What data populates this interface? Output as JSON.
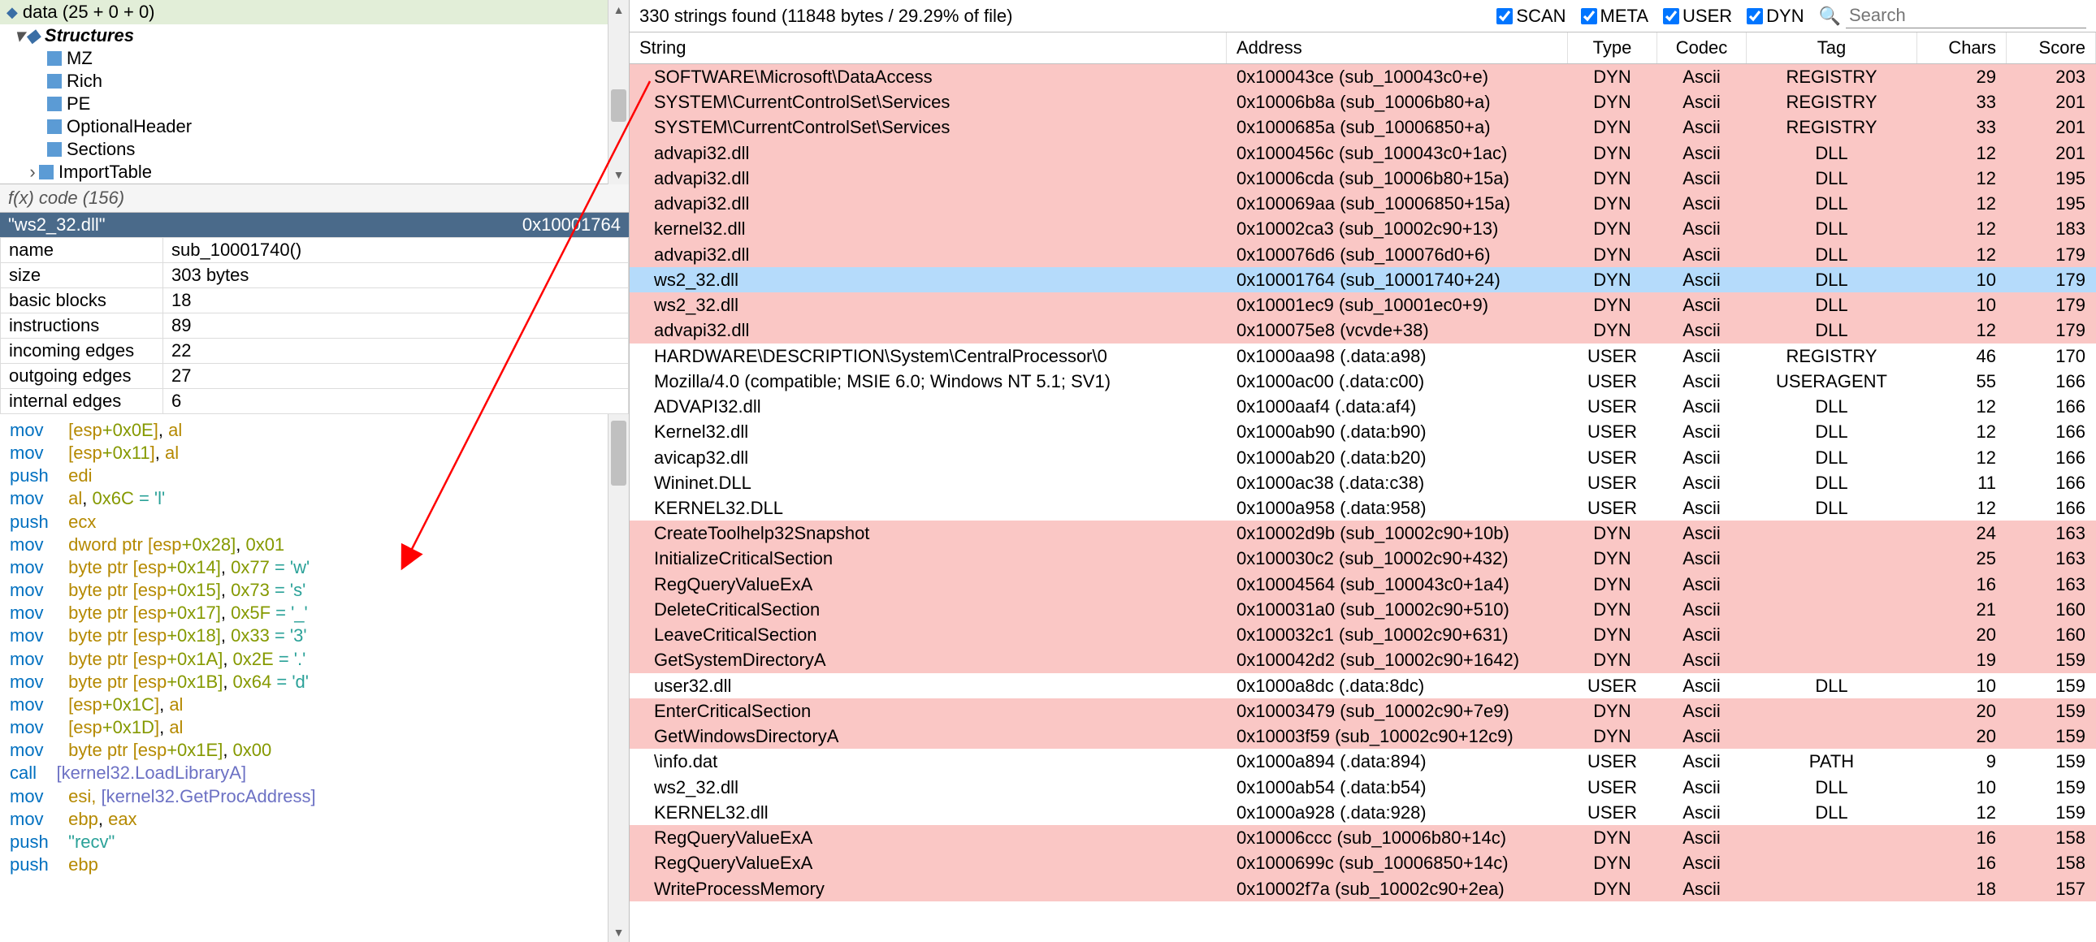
{
  "tree": {
    "header": "data (25 + 0 + 0)",
    "structures_label": "Structures",
    "items": [
      "MZ",
      "Rich",
      "PE",
      "OptionalHeader",
      "Sections",
      "ImportTable"
    ]
  },
  "fxbar": "f(x) code (156)",
  "funchdr": {
    "name": "\"ws2_32.dll\"",
    "addr": "0x10001764"
  },
  "props": [
    {
      "k": "name",
      "v": "sub_10001740()"
    },
    {
      "k": "size",
      "v": "303 bytes"
    },
    {
      "k": "basic blocks",
      "v": "18"
    },
    {
      "k": "instructions",
      "v": "89"
    },
    {
      "k": "incoming edges",
      "v": "22"
    },
    {
      "k": "outgoing edges",
      "v": "27"
    },
    {
      "k": "internal edges",
      "v": "6"
    }
  ],
  "asm": [
    {
      "m": "mov",
      "ops": [
        {
          "t": "mem",
          "s": "[",
          "r": "esp",
          "o": "+0x0E",
          "e": "]"
        },
        {
          "t": "reg",
          "s": ", ",
          "r": "al"
        }
      ]
    },
    {
      "m": "mov",
      "ops": [
        {
          "t": "mem",
          "s": "[",
          "r": "esp",
          "o": "+0x11",
          "e": "]"
        },
        {
          "t": "reg",
          "s": ", ",
          "r": "al"
        }
      ]
    },
    {
      "m": "push",
      "ops": [
        {
          "t": "reg",
          "r": "edi"
        }
      ]
    },
    {
      "m": "mov",
      "ops": [
        {
          "t": "reg",
          "r": "al"
        },
        {
          "t": "imm",
          "s": ", ",
          "v": "0x6C",
          "c": " = 'l'"
        }
      ]
    },
    {
      "m": "push",
      "ops": [
        {
          "t": "reg",
          "r": "ecx"
        }
      ]
    },
    {
      "m": "mov",
      "ops": [
        {
          "t": "txt",
          "s": "dword ptr ["
        },
        {
          "t": "reg",
          "r": "esp"
        },
        {
          "t": "txt2",
          "s": "+0x28], "
        },
        {
          "t": "num",
          "v": "0x01"
        }
      ]
    },
    {
      "m": "mov",
      "ops": [
        {
          "t": "txt",
          "s": "byte ptr ["
        },
        {
          "t": "reg",
          "r": "esp"
        },
        {
          "t": "txt2",
          "s": "+0x14], "
        },
        {
          "t": "num",
          "v": "0x77"
        },
        {
          "t": "ch",
          "s": " = 'w'"
        }
      ]
    },
    {
      "m": "mov",
      "ops": [
        {
          "t": "txt",
          "s": "byte ptr ["
        },
        {
          "t": "reg",
          "r": "esp"
        },
        {
          "t": "txt2",
          "s": "+0x15], "
        },
        {
          "t": "num",
          "v": "0x73"
        },
        {
          "t": "ch",
          "s": " = 's'"
        }
      ]
    },
    {
      "m": "mov",
      "ops": [
        {
          "t": "txt",
          "s": "byte ptr ["
        },
        {
          "t": "reg",
          "r": "esp"
        },
        {
          "t": "txt2",
          "s": "+0x17], "
        },
        {
          "t": "num",
          "v": "0x5F"
        },
        {
          "t": "ch",
          "s": " = '_'"
        }
      ]
    },
    {
      "m": "mov",
      "ops": [
        {
          "t": "txt",
          "s": "byte ptr ["
        },
        {
          "t": "reg",
          "r": "esp"
        },
        {
          "t": "txt2",
          "s": "+0x18], "
        },
        {
          "t": "num",
          "v": "0x33"
        },
        {
          "t": "ch",
          "s": " = '3'"
        }
      ]
    },
    {
      "m": "mov",
      "ops": [
        {
          "t": "txt",
          "s": "byte ptr ["
        },
        {
          "t": "reg",
          "r": "esp"
        },
        {
          "t": "txt2",
          "s": "+0x1A], "
        },
        {
          "t": "num",
          "v": "0x2E"
        },
        {
          "t": "ch",
          "s": " = '.'"
        }
      ]
    },
    {
      "m": "mov",
      "ops": [
        {
          "t": "txt",
          "s": "byte ptr ["
        },
        {
          "t": "reg",
          "r": "esp"
        },
        {
          "t": "txt2",
          "s": "+0x1B], "
        },
        {
          "t": "num",
          "v": "0x64"
        },
        {
          "t": "ch",
          "s": " = 'd'"
        }
      ]
    },
    {
      "m": "mov",
      "ops": [
        {
          "t": "mem",
          "s": "[",
          "r": "esp",
          "o": "+0x1C",
          "e": "]"
        },
        {
          "t": "reg",
          "s": ", ",
          "r": "al"
        }
      ]
    },
    {
      "m": "mov",
      "ops": [
        {
          "t": "mem",
          "s": "[",
          "r": "esp",
          "o": "+0x1D",
          "e": "]"
        },
        {
          "t": "reg",
          "s": ", ",
          "r": "al"
        }
      ]
    },
    {
      "m": "mov",
      "ops": [
        {
          "t": "txt",
          "s": "byte ptr ["
        },
        {
          "t": "reg",
          "r": "esp"
        },
        {
          "t": "txt2",
          "s": "+0x1E], "
        },
        {
          "t": "num",
          "v": "0x00"
        }
      ]
    },
    {
      "m": "call",
      "ops": [
        {
          "t": "api",
          "s": "[kernel32.LoadLibraryA]"
        }
      ]
    },
    {
      "m": "mov",
      "ops": [
        {
          "t": "reg",
          "r": "esi"
        },
        {
          "t": "txt",
          "s": ", "
        },
        {
          "t": "api",
          "s": "[kernel32.GetProcAddress]"
        }
      ]
    },
    {
      "m": "mov",
      "ops": [
        {
          "t": "reg",
          "r": "ebp"
        },
        {
          "t": "reg",
          "s": ", ",
          "r": "eax"
        }
      ]
    },
    {
      "m": "push",
      "ops": [
        {
          "t": "str",
          "s": "\"recv\""
        }
      ]
    },
    {
      "m": "push",
      "ops": [
        {
          "t": "reg",
          "r": "ebp"
        }
      ]
    }
  ],
  "status": {
    "text": "330 strings found (11848 bytes / 29.29% of file)",
    "checks": [
      "SCAN",
      "META",
      "USER",
      "DYN"
    ],
    "search_ph": "Search"
  },
  "cols": [
    "String",
    "Address",
    "Type",
    "Codec",
    "Tag",
    "Chars",
    "Score"
  ],
  "rows": [
    {
      "c": "pink",
      "s": "SOFTWARE\\Microsoft\\DataAccess",
      "a": "0x100043ce (sub_100043c0+e)",
      "ty": "DYN",
      "co": "Ascii",
      "tg": "REGISTRY",
      "ch": "29",
      "sc": "203"
    },
    {
      "c": "pink",
      "s": "SYSTEM\\CurrentControlSet\\Services",
      "a": "0x10006b8a (sub_10006b80+a)",
      "ty": "DYN",
      "co": "Ascii",
      "tg": "REGISTRY",
      "ch": "33",
      "sc": "201"
    },
    {
      "c": "pink",
      "s": "SYSTEM\\CurrentControlSet\\Services",
      "a": "0x1000685a (sub_10006850+a)",
      "ty": "DYN",
      "co": "Ascii",
      "tg": "REGISTRY",
      "ch": "33",
      "sc": "201"
    },
    {
      "c": "pink",
      "s": "advapi32.dll",
      "a": "0x1000456c (sub_100043c0+1ac)",
      "ty": "DYN",
      "co": "Ascii",
      "tg": "DLL",
      "ch": "12",
      "sc": "201"
    },
    {
      "c": "pink",
      "s": "advapi32.dll",
      "a": "0x10006cda (sub_10006b80+15a)",
      "ty": "DYN",
      "co": "Ascii",
      "tg": "DLL",
      "ch": "12",
      "sc": "195"
    },
    {
      "c": "pink",
      "s": "advapi32.dll",
      "a": "0x100069aa (sub_10006850+15a)",
      "ty": "DYN",
      "co": "Ascii",
      "tg": "DLL",
      "ch": "12",
      "sc": "195"
    },
    {
      "c": "pink",
      "s": "kernel32.dll",
      "a": "0x10002ca3 (sub_10002c90+13)",
      "ty": "DYN",
      "co": "Ascii",
      "tg": "DLL",
      "ch": "12",
      "sc": "183"
    },
    {
      "c": "pink",
      "s": "advapi32.dll",
      "a": "0x100076d6 (sub_100076d0+6)",
      "ty": "DYN",
      "co": "Ascii",
      "tg": "DLL",
      "ch": "12",
      "sc": "179"
    },
    {
      "c": "sel",
      "s": "ws2_32.dll",
      "a": "0x10001764 (sub_10001740+24)",
      "ty": "DYN",
      "co": "Ascii",
      "tg": "DLL",
      "ch": "10",
      "sc": "179"
    },
    {
      "c": "pink",
      "s": "ws2_32.dll",
      "a": "0x10001ec9 (sub_10001ec0+9)",
      "ty": "DYN",
      "co": "Ascii",
      "tg": "DLL",
      "ch": "10",
      "sc": "179"
    },
    {
      "c": "pink",
      "s": "advapi32.dll",
      "a": "0x100075e8 (vcvde+38)",
      "ty": "DYN",
      "co": "Ascii",
      "tg": "DLL",
      "ch": "12",
      "sc": "179"
    },
    {
      "c": "white",
      "s": "HARDWARE\\DESCRIPTION\\System\\CentralProcessor\\0",
      "a": "0x1000aa98 (.data:a98)",
      "ty": "USER",
      "co": "Ascii",
      "tg": "REGISTRY",
      "ch": "46",
      "sc": "170"
    },
    {
      "c": "white",
      "s": "Mozilla/4.0 (compatible; MSIE 6.0; Windows NT 5.1; SV1)",
      "a": "0x1000ac00 (.data:c00)",
      "ty": "USER",
      "co": "Ascii",
      "tg": "USERAGENT",
      "ch": "55",
      "sc": "166"
    },
    {
      "c": "white",
      "s": "ADVAPI32.dll",
      "a": "0x1000aaf4 (.data:af4)",
      "ty": "USER",
      "co": "Ascii",
      "tg": "DLL",
      "ch": "12",
      "sc": "166"
    },
    {
      "c": "white",
      "s": "Kernel32.dll",
      "a": "0x1000ab90 (.data:b90)",
      "ty": "USER",
      "co": "Ascii",
      "tg": "DLL",
      "ch": "12",
      "sc": "166"
    },
    {
      "c": "white",
      "s": "avicap32.dll",
      "a": "0x1000ab20 (.data:b20)",
      "ty": "USER",
      "co": "Ascii",
      "tg": "DLL",
      "ch": "12",
      "sc": "166"
    },
    {
      "c": "white",
      "s": "Wininet.DLL",
      "a": "0x1000ac38 (.data:c38)",
      "ty": "USER",
      "co": "Ascii",
      "tg": "DLL",
      "ch": "11",
      "sc": "166"
    },
    {
      "c": "white",
      "s": "KERNEL32.DLL",
      "a": "0x1000a958 (.data:958)",
      "ty": "USER",
      "co": "Ascii",
      "tg": "DLL",
      "ch": "12",
      "sc": "166"
    },
    {
      "c": "pink",
      "s": "CreateToolhelp32Snapshot",
      "a": "0x10002d9b (sub_10002c90+10b)",
      "ty": "DYN",
      "co": "Ascii",
      "tg": "",
      "ch": "24",
      "sc": "163"
    },
    {
      "c": "pink",
      "s": "InitializeCriticalSection",
      "a": "0x100030c2 (sub_10002c90+432)",
      "ty": "DYN",
      "co": "Ascii",
      "tg": "",
      "ch": "25",
      "sc": "163"
    },
    {
      "c": "pink",
      "s": "RegQueryValueExA",
      "a": "0x10004564 (sub_100043c0+1a4)",
      "ty": "DYN",
      "co": "Ascii",
      "tg": "",
      "ch": "16",
      "sc": "163"
    },
    {
      "c": "pink",
      "s": "DeleteCriticalSection",
      "a": "0x100031a0 (sub_10002c90+510)",
      "ty": "DYN",
      "co": "Ascii",
      "tg": "",
      "ch": "21",
      "sc": "160"
    },
    {
      "c": "pink",
      "s": "LeaveCriticalSection",
      "a": "0x100032c1 (sub_10002c90+631)",
      "ty": "DYN",
      "co": "Ascii",
      "tg": "",
      "ch": "20",
      "sc": "160"
    },
    {
      "c": "pink",
      "s": "GetSystemDirectoryA",
      "a": "0x100042d2 (sub_10002c90+1642)",
      "ty": "DYN",
      "co": "Ascii",
      "tg": "",
      "ch": "19",
      "sc": "159"
    },
    {
      "c": "white",
      "s": "user32.dll",
      "a": "0x1000a8dc (.data:8dc)",
      "ty": "USER",
      "co": "Ascii",
      "tg": "DLL",
      "ch": "10",
      "sc": "159"
    },
    {
      "c": "pink",
      "s": "EnterCriticalSection",
      "a": "0x10003479 (sub_10002c90+7e9)",
      "ty": "DYN",
      "co": "Ascii",
      "tg": "",
      "ch": "20",
      "sc": "159"
    },
    {
      "c": "pink",
      "s": "GetWindowsDirectoryA",
      "a": "0x10003f59 (sub_10002c90+12c9)",
      "ty": "DYN",
      "co": "Ascii",
      "tg": "",
      "ch": "20",
      "sc": "159"
    },
    {
      "c": "white",
      "s": "\\info.dat",
      "a": "0x1000a894 (.data:894)",
      "ty": "USER",
      "co": "Ascii",
      "tg": "PATH",
      "ch": "9",
      "sc": "159"
    },
    {
      "c": "white",
      "s": "ws2_32.dll",
      "a": "0x1000ab54 (.data:b54)",
      "ty": "USER",
      "co": "Ascii",
      "tg": "DLL",
      "ch": "10",
      "sc": "159"
    },
    {
      "c": "white",
      "s": "KERNEL32.dll",
      "a": "0x1000a928 (.data:928)",
      "ty": "USER",
      "co": "Ascii",
      "tg": "DLL",
      "ch": "12",
      "sc": "159"
    },
    {
      "c": "pink",
      "s": "RegQueryValueExA",
      "a": "0x10006ccc (sub_10006b80+14c)",
      "ty": "DYN",
      "co": "Ascii",
      "tg": "",
      "ch": "16",
      "sc": "158"
    },
    {
      "c": "pink",
      "s": "RegQueryValueExA",
      "a": "0x1000699c (sub_10006850+14c)",
      "ty": "DYN",
      "co": "Ascii",
      "tg": "",
      "ch": "16",
      "sc": "158"
    },
    {
      "c": "pink",
      "s": "WriteProcessMemory",
      "a": "0x10002f7a (sub_10002c90+2ea)",
      "ty": "DYN",
      "co": "Ascii",
      "tg": "",
      "ch": "18",
      "sc": "157"
    }
  ]
}
